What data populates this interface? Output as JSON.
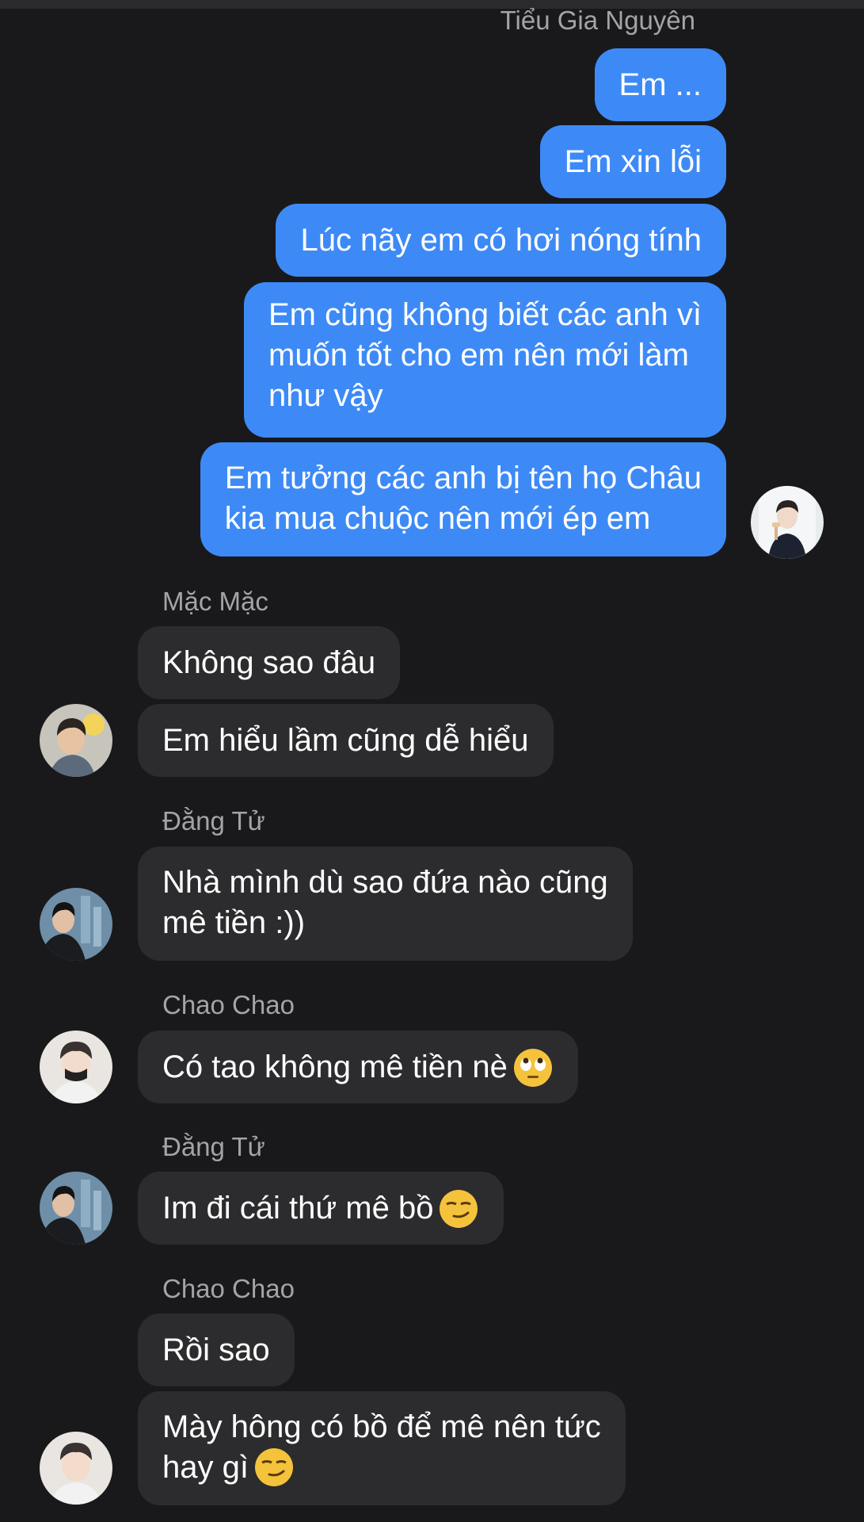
{
  "thread": {
    "sender_top": "Tiểu Gia Nguyên",
    "my_messages": [
      "Em ...",
      "Em xin lỗi",
      "Lúc nãy em có hơi nóng tính",
      [
        "Em cũng không biết các anh vì",
        "muốn tốt cho em nên mới làm",
        "như vậy"
      ],
      [
        "Em tưởng các anh bị tên họ Châu",
        "kia mua chuộc nên mới ép em"
      ]
    ],
    "groups": [
      {
        "sender": "Mặc Mặc",
        "messages": [
          "Không sao đâu",
          "Em hiểu lầm cũng dễ hiểu"
        ]
      },
      {
        "sender": "Đằng Tử",
        "messages": [
          [
            "Nhà mình dù sao đứa nào cũng",
            "mê tiền :))"
          ]
        ]
      },
      {
        "sender": "Chao Chao",
        "messages": [
          "Có tao không mê tiền nè"
        ],
        "emoji": "eye-roll-emoji"
      },
      {
        "sender": "Đằng Tử",
        "messages": [
          "Im đi cái thứ mê bồ"
        ],
        "emoji": "smirk-emoji"
      },
      {
        "sender": "Chao Chao",
        "messages": [
          "Rồi sao",
          [
            "Mày hông có bồ để mê nên tức",
            "hay gì"
          ]
        ],
        "emoji": "smirk-emoji"
      }
    ]
  },
  "colors": {
    "background": "#19191b",
    "my_bubble": "#3d8af7",
    "their_bubble": "#2c2c2e",
    "sender_name": "#a4a4a8"
  }
}
